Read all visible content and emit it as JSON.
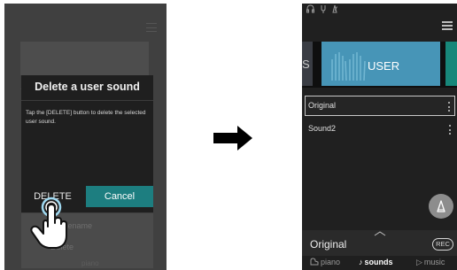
{
  "left": {
    "dialog": {
      "title": "Delete a user sound",
      "message": "Tap the [DELETE] button to delete the selected user sound.",
      "delete_label": "DELETE",
      "cancel_label": "Cancel"
    },
    "background_menu": {
      "rename_label": "Rename",
      "delete_label": "Delete",
      "tab_piano": "piano"
    },
    "colors": {
      "cancel_button": "#1d7e80",
      "dialog_bg": "#1f1f1f"
    }
  },
  "right": {
    "categories": {
      "prev_label": "S",
      "current_label": "USER"
    },
    "list": [
      {
        "label": "Original",
        "selected": true
      },
      {
        "label": "Sound2",
        "selected": false
      }
    ],
    "bottom": {
      "current_sound": "Original",
      "rec_label": "REC",
      "tabs": [
        {
          "label": "piano",
          "icon": "piano-icon",
          "active": false
        },
        {
          "label": "sounds",
          "icon": "music-note-icon",
          "active": true
        },
        {
          "label": "music",
          "icon": "play-icon",
          "active": false
        }
      ]
    },
    "icons": [
      "headphones-icon",
      "tuning-fork-icon",
      "metronome-icon",
      "menu-icon",
      "metronome-icon",
      "chevron-up-icon",
      "kebab-menu-icon"
    ],
    "colors": {
      "user_tile": "#4795b7",
      "next_tile": "#17877a",
      "background": "#202020"
    }
  }
}
